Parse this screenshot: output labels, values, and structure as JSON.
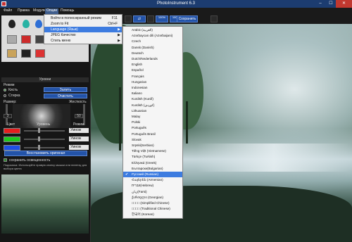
{
  "window": {
    "title": "PhotoInstrument 6.3",
    "minimize": "–",
    "maximize": "☐",
    "close": "✕"
  },
  "menubar": {
    "items": [
      "Файл",
      "Правка",
      "Модули",
      "Опции",
      "Помощь"
    ],
    "active_index": 3
  },
  "options_menu": {
    "items": [
      {
        "label": "Войти в полноэкранный режим",
        "shortcut": "F11"
      },
      {
        "label": "Zoom to Fit",
        "shortcut": "Ctrl+F"
      },
      {
        "label": "Language (Язык)",
        "shortcut": "",
        "submenu": true
      },
      {
        "label": "JPEG Качество",
        "shortcut": "",
        "submenu": true
      },
      {
        "label": "Стиль меню",
        "shortcut": "",
        "submenu": true
      }
    ],
    "highlighted_index": 2
  },
  "language_submenu": {
    "items": [
      "Arabic (العربية)",
      "Azərbaycan dili (Azərbaijani)",
      "Czech",
      "Dansk (Danish)",
      "Deutsch",
      "Dutch/Nederlands",
      "English",
      "Español",
      "Français",
      "Hungarian",
      "Indonesian",
      "Italiano",
      "Kurdish (Kurdî)",
      "Kurdish (کوردی)",
      "Lithuanian",
      "Malay",
      "Polski",
      "Português",
      "Português Brasil",
      "Slovak",
      "Srpski(Serbian)",
      "Tiếng Việt (Vietnamese)",
      "Türkçe (Turkish)",
      "Ελληνικά (Greek)",
      "Български(Bulgarian)",
      "Русский (Russian)",
      "Հայերեն (Armenian)",
      "עברית(Hebrew)",
      "زبان(Farsi)",
      "ქართული (Georgian)",
      "□□□□ (Simplified Chinese)",
      "□□□□ (Traditional Chinese)",
      "한국어 (Korean)"
    ],
    "selected_index": 25,
    "check": "✔"
  },
  "left_panel": {
    "section_title": "Уровни",
    "mode_label": "Режим",
    "radio_brush": "Кисть",
    "radio_erase": "Стирка",
    "fill_button": "Залить",
    "clear_button": "Очистить",
    "size_label": "Размер:",
    "hardness_label": "Жесткость",
    "size_value": "3",
    "hardness_value": "50",
    "color_header": "Цвет",
    "level_header": "Уровень",
    "mode_header": "Режим",
    "rows": [
      {
        "color": "#e61e1e",
        "mode": "Умнож"
      },
      {
        "color": "#1ec81e",
        "mode": "Умнож"
      },
      {
        "color": "#1e50e6",
        "mode": "Умнож"
      }
    ],
    "restore_button": "Восстановить оригинал",
    "keep_brightness": "сохранить освещенность",
    "hint": "Подсказка: Используйте правую кнопку мышки или пипетку для выбора цвета"
  },
  "toolbar": {
    "zoom_in_label": "100%",
    "zoom_out_label": "100%",
    "save_button": "Сохранить"
  }
}
